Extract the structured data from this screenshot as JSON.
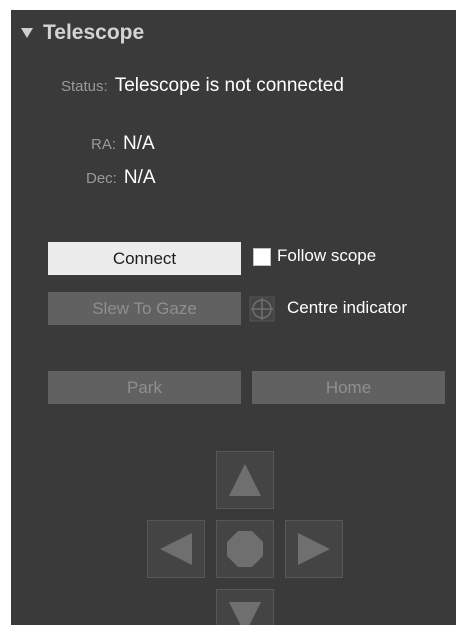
{
  "section": {
    "title": "Telescope",
    "expander_icon": "triangle-down-icon"
  },
  "status": {
    "label": "Status:",
    "value": "Telescope is not connected"
  },
  "ra": {
    "label": "RA:",
    "value": "N/A"
  },
  "dec": {
    "label": "Dec:",
    "value": "N/A"
  },
  "buttons": {
    "connect": "Connect",
    "slew_to_gaze": "Slew To Gaze",
    "park": "Park",
    "home": "Home"
  },
  "options": {
    "follow_scope": "Follow scope",
    "centre_indicator": "Centre indicator"
  },
  "nav_pad": {
    "up_icon": "arrow-up-icon",
    "left_icon": "arrow-left-icon",
    "stop_icon": "stop-octagon-icon",
    "right_icon": "arrow-right-icon",
    "down_icon": "arrow-down-icon"
  }
}
